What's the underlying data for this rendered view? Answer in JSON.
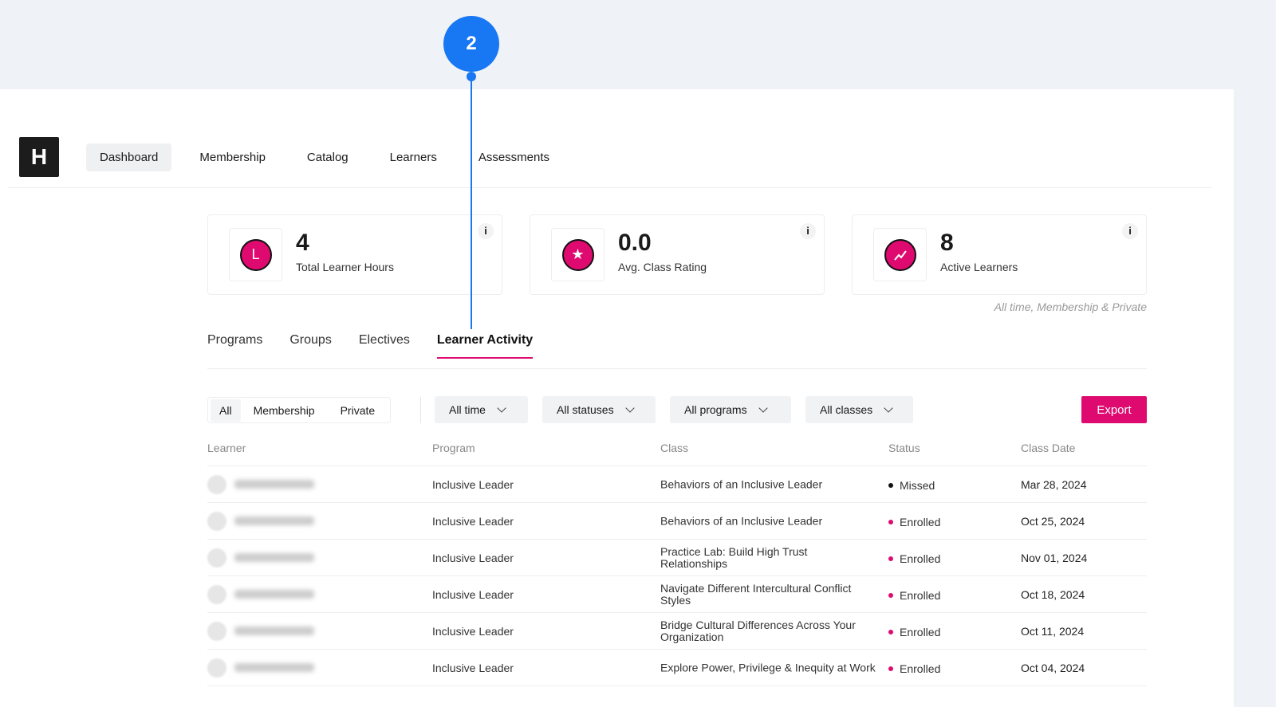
{
  "logo": "H",
  "nav": [
    "Dashboard",
    "Membership",
    "Catalog",
    "Learners",
    "Assessments"
  ],
  "stats": [
    {
      "value": "4",
      "label": "Total Learner Hours",
      "icon": "clock-icon"
    },
    {
      "value": "0.0",
      "label": "Avg. Class Rating",
      "icon": "star-icon"
    },
    {
      "value": "8",
      "label": "Active Learners",
      "icon": "trend-up-icon"
    }
  ],
  "info_label": "i",
  "stats_note": "All time, Membership & Private",
  "tabs": [
    "Programs",
    "Groups",
    "Electives",
    "Learner Activity"
  ],
  "segments": [
    "All",
    "Membership",
    "Private"
  ],
  "filters": [
    "All time",
    "All statuses",
    "All programs",
    "All classes"
  ],
  "export_label": "Export",
  "columns": [
    "Learner",
    "Program",
    "Class",
    "Status",
    "Class Date"
  ],
  "rows": [
    {
      "program": "Inclusive Leader",
      "class": "Behaviors of an Inclusive Leader",
      "status": "Missed",
      "date": "Mar 28, 2024"
    },
    {
      "program": "Inclusive Leader",
      "class": "Behaviors of an Inclusive Leader",
      "status": "Enrolled",
      "date": "Oct 25, 2024"
    },
    {
      "program": "Inclusive Leader",
      "class": "Practice Lab: Build High Trust Relationships",
      "status": "Enrolled",
      "date": "Nov 01, 2024"
    },
    {
      "program": "Inclusive Leader",
      "class": "Navigate Different Intercultural Conflict Styles",
      "status": "Enrolled",
      "date": "Oct 18, 2024"
    },
    {
      "program": "Inclusive Leader",
      "class": "Bridge Cultural Differences Across Your Organization",
      "status": "Enrolled",
      "date": "Oct 11, 2024"
    },
    {
      "program": "Inclusive Leader",
      "class": "Explore Power, Privilege & Inequity at Work",
      "status": "Enrolled",
      "date": "Oct 04, 2024"
    }
  ],
  "status_colors": {
    "Missed": "#111111",
    "Enrolled": "#df0a6f"
  },
  "accent": "#df0a6f",
  "annotation": {
    "number": "2",
    "color": "#1877f2"
  }
}
